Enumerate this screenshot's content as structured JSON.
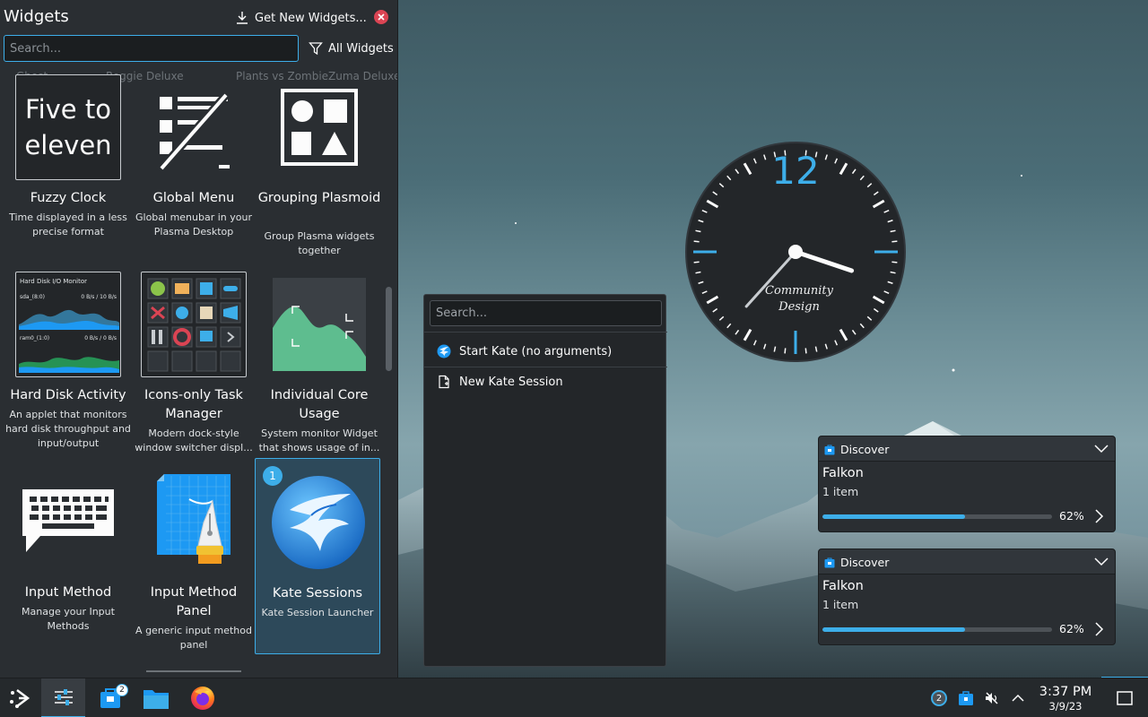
{
  "panel": {
    "title": "Widgets",
    "get_new_label": "Get New Widgets...",
    "search_placeholder": "Search...",
    "filter_label": "All Widgets",
    "ghost_row": [
      "Ghost",
      "Reggie Deluxe",
      "Plants vs Zombie",
      "Zuma Deluxe"
    ]
  },
  "widgets": [
    {
      "name": "Fuzzy Clock",
      "desc": "Time displayed in a less precise format",
      "thumb_text": "Five to eleven"
    },
    {
      "name": "Global Menu",
      "desc": "Global menubar in your Plasma Desktop"
    },
    {
      "name": "Grouping Plasmoid",
      "desc": "Group Plasma widgets together"
    },
    {
      "name": "Hard Disk Activity",
      "desc": "An applet that monitors hard disk throughput and input/output",
      "thumb": {
        "title": "Hard Disk I/O Monitor",
        "r1_label": "sda_(8:0)",
        "r1_val": "0 B/s / 10 B/s",
        "r2_label": "ram0_(1:0)",
        "r2_val": "0 B/s / 0 B/s"
      }
    },
    {
      "name": "Icons-only Task Manager",
      "desc": "Modern dock-style window switcher displ..."
    },
    {
      "name": "Individual Core Usage",
      "desc": "System monitor Widget that shows usage of in..."
    },
    {
      "name": "Input Method",
      "desc": "Manage your Input Methods"
    },
    {
      "name": "Input Method Panel",
      "desc": "A generic input method panel"
    },
    {
      "name": "Kate Sessions",
      "desc": "Kate Session Launcher",
      "badge": "1"
    }
  ],
  "clock": {
    "numeral": "12",
    "brand_line1": "Community",
    "brand_line2": "Design",
    "hour": 3,
    "minute": 37
  },
  "kate_popup": {
    "search_placeholder": "Search...",
    "items": [
      "Start Kate (no arguments)",
      "New Kate Session"
    ]
  },
  "notifications": [
    {
      "app": "Discover",
      "title": "Falkon",
      "subtitle": "1 item",
      "progress": 62,
      "progress_label": "62%"
    },
    {
      "app": "Discover",
      "title": "Falkon",
      "subtitle": "1 item",
      "progress": 62,
      "progress_label": "62%"
    }
  ],
  "taskbar": {
    "discover_count": "2",
    "tray_notification_count": "2",
    "time": "3:37 PM",
    "date": "3/9/23"
  },
  "colors": {
    "accent": "#3daee9",
    "panel_bg": "#2a2e32",
    "close": "#da4453",
    "taskbar_bg": "#25292c"
  }
}
